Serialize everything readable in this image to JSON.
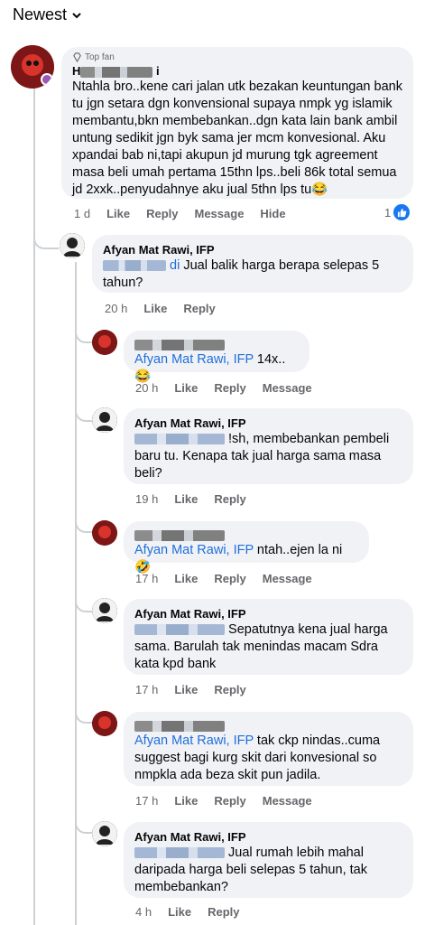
{
  "sort": {
    "label": "Newest"
  },
  "top_comment": {
    "badge": "Top fan",
    "name_visible": "H",
    "name_suffix": "i",
    "text": "Ntahla bro..kene cari jalan utk bezakan keuntungan bank tu jgn setara dgn konvensional supaya nmpk yg islamik membantu,bkn membebankan..dgn kata lain bank ambil untung sedikit jgn byk sama jer mcm konvesional. Aku xpandai bab ni,tapi akupun jd murung tgk agreement masa beli umah pertama 15thn lps..beli 86k total  semua jd 2xxk..penyudahnye aku jual 5thn lps tu😂",
    "time": "1 d",
    "like": "Like",
    "reply": "Reply",
    "message": "Message",
    "hide": "Hide",
    "reaction_count": "1"
  },
  "replies": [
    {
      "name": "Afyan Mat Rawi, IFP",
      "prefix": "",
      "partial": "di",
      "text": "Jual balik harga berapa selepas 5 tahun?",
      "time": "20 h",
      "like": "Like",
      "reply": "Reply"
    },
    {
      "name": "",
      "mention": "Afyan Mat Rawi, IFP",
      "text": " 14x..😂",
      "time": "20 h",
      "like": "Like",
      "reply": "Reply",
      "message": "Message"
    },
    {
      "name": "Afyan Mat Rawi, IFP",
      "partial": "!sh,",
      "text": " membebankan pembeli baru tu. Kenapa tak jual harga sama masa beli?",
      "time": "19 h",
      "like": "Like",
      "reply": "Reply"
    },
    {
      "name": "",
      "mention": "Afyan Mat Rawi, IFP",
      "text": " ntah..ejen la ni 🤣",
      "time": "17 h",
      "like": "Like",
      "reply": "Reply",
      "message": "Message"
    },
    {
      "name": "Afyan Mat Rawi, IFP",
      "text": "Sepatutnya kena jual harga sama. Barulah tak menindas macam Sdra kata kpd bank",
      "time": "17 h",
      "like": "Like",
      "reply": "Reply"
    },
    {
      "name": "",
      "mention": "Afyan Mat Rawi, IFP",
      "text": " tak ckp nindas..cuma suggest bagi kurg skit dari konvesional so nmpkla ada beza skit pun jadila.",
      "time": "17 h",
      "like": "Like",
      "reply": "Reply",
      "message": "Message"
    },
    {
      "name": "Afyan Mat Rawi, IFP",
      "text": "Jual rumah lebih mahal daripada harga beli selepas 5 tahun, tak membebankan?",
      "time": "4 h",
      "like": "Like",
      "reply": "Reply"
    }
  ],
  "colors": {
    "link": "#216fdb",
    "meta": "#65676b",
    "bubble": "#f0f2f5",
    "like_badge": "#1877f2"
  }
}
